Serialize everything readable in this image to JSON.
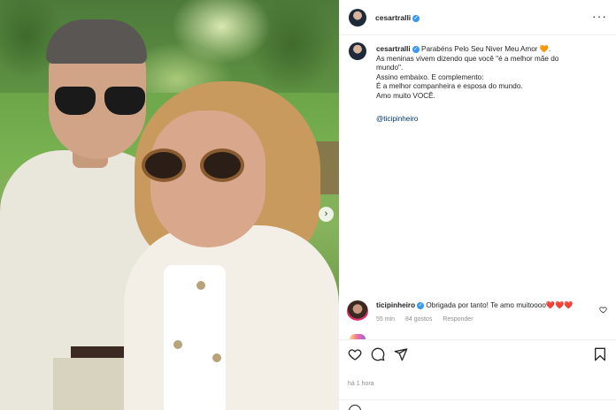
{
  "post": {
    "author": "cesartralli",
    "caption_lines": [
      "Parabéns Pelo Seu Niver Meu Amor",
      "As meninas vivem dizendo que você \"é a melhor mãe do",
      "mundo\".",
      "Assino embaixo. E complemento:",
      "É a melhor companheira e esposa do mundo.",
      "Amo muito VOCÊ."
    ],
    "heart_emoji": "🧡",
    "period": ".",
    "mention": "@ticipinheiro",
    "posted_ago": "há 1 hora"
  },
  "comment": {
    "author": "ticipinheiro",
    "text": "Obrigada por tanto! Te amo muitoooo",
    "hearts": "❤️❤️❤️",
    "time": "55 min",
    "likes": "84 gostos",
    "reply": "Responder"
  },
  "icons": {
    "more": "more-options-icon",
    "verified": "verified-badge-icon",
    "like": "heart-icon",
    "comment": "comment-icon",
    "share": "share-icon",
    "save": "bookmark-icon",
    "next": "carousel-next-icon"
  },
  "colors": {
    "verified": "#3897f0",
    "mention": "#00376b",
    "muted": "#8e8e8e"
  }
}
